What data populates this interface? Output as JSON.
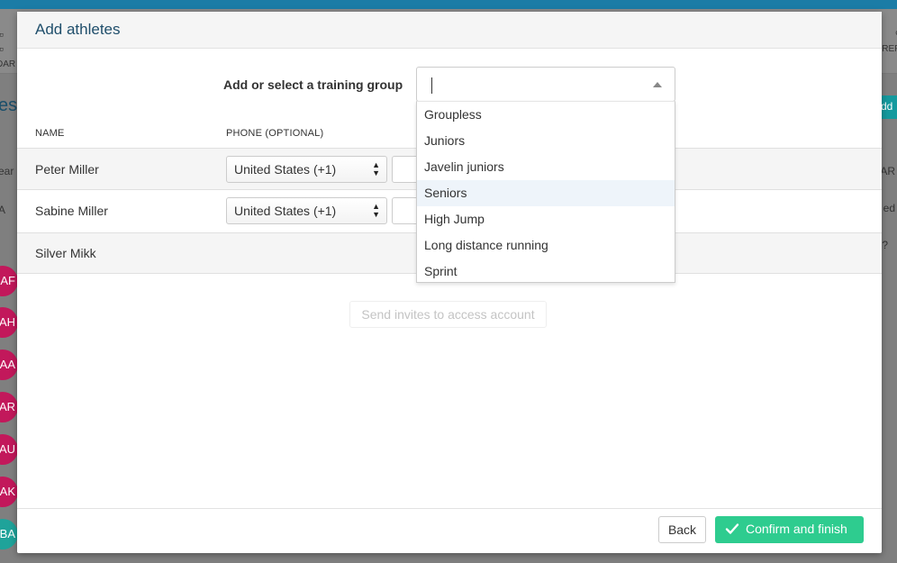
{
  "background": {
    "nav_left_label": "DAR",
    "nav_right_label": "REFI",
    "heading": "es",
    "add_label": "dd",
    "side_left": [
      "ear",
      "A"
    ],
    "side_right": [
      "AR",
      "ed"
    ],
    "avatars": [
      {
        "initials": "AF",
        "color": "#c2185b"
      },
      {
        "initials": "AH",
        "color": "#c2185b"
      },
      {
        "initials": "AA",
        "color": "#c2185b"
      },
      {
        "initials": "AR",
        "color": "#c2185b"
      },
      {
        "initials": "AU",
        "color": "#c2185b"
      },
      {
        "initials": "AK",
        "color": "#c2185b"
      },
      {
        "initials": "BA",
        "color": "#1fa39a"
      }
    ]
  },
  "modal": {
    "title": "Add athletes",
    "group_label": "Add or select a training group",
    "group_input_value": "",
    "columns": {
      "name": "NAME",
      "phone": "PHONE (OPTIONAL)"
    },
    "athletes": [
      {
        "name": "Peter Miller",
        "country": "United States (+1)"
      },
      {
        "name": "Sabine Miller",
        "country": "United States (+1)"
      },
      {
        "name": "Silver Mikk"
      }
    ],
    "dropdown_options": [
      "Groupless",
      "Juniors",
      "Javelin juniors",
      "Seniors",
      "High Jump",
      "Long distance running",
      "Sprint"
    ],
    "dropdown_highlighted": "Seniors",
    "invite_button": "Send invites to access account",
    "back_button": "Back",
    "confirm_button": "Confirm and finish",
    "colors": {
      "confirm": "#2ecc8f",
      "title": "#1f4e6b",
      "highlight": "#eef4fa"
    }
  }
}
